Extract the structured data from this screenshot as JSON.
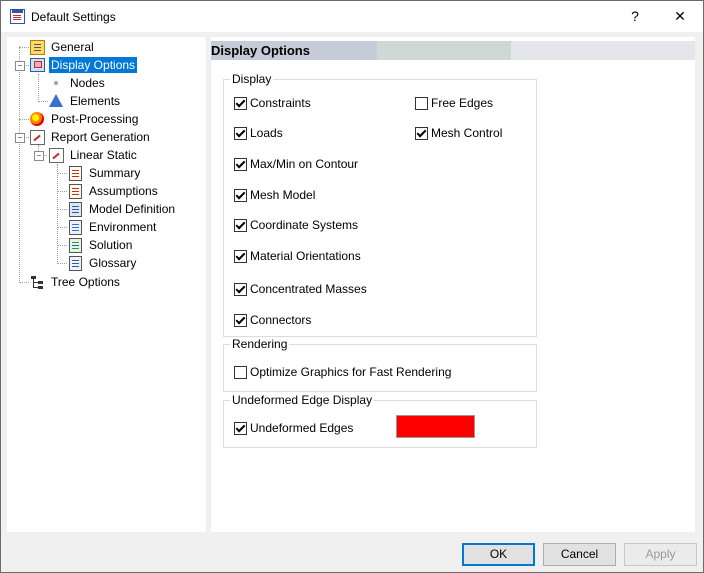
{
  "window": {
    "title": "Default Settings",
    "help_label": "?",
    "close_label": "✕"
  },
  "tree": {
    "nodes": [
      {
        "label": "General"
      },
      {
        "label": "Display Options"
      },
      {
        "label": "Nodes"
      },
      {
        "label": "Elements"
      },
      {
        "label": "Post-Processing"
      },
      {
        "label": "Report Generation"
      },
      {
        "label": "Linear Static"
      },
      {
        "label": "Summary"
      },
      {
        "label": "Assumptions"
      },
      {
        "label": "Model Definition"
      },
      {
        "label": "Environment"
      },
      {
        "label": "Solution"
      },
      {
        "label": "Glossary"
      },
      {
        "label": "Tree Options"
      }
    ],
    "selected": "Display Options"
  },
  "panel": {
    "header": "Display Options",
    "display_group": {
      "title": "Display",
      "options": [
        {
          "label": "Constraints",
          "checked": true
        },
        {
          "label": "Loads",
          "checked": true
        },
        {
          "label": "Max/Min on Contour",
          "checked": true
        },
        {
          "label": "Mesh Model",
          "checked": true
        },
        {
          "label": "Coordinate Systems",
          "checked": true
        },
        {
          "label": "Material Orientations",
          "checked": true
        },
        {
          "label": "Concentrated Masses",
          "checked": true
        },
        {
          "label": "Connectors",
          "checked": true
        },
        {
          "label": "Free Edges",
          "checked": false
        },
        {
          "label": "Mesh Control",
          "checked": true
        }
      ]
    },
    "rendering_group": {
      "title": "Rendering",
      "options": [
        {
          "label": "Optimize Graphics for Fast Rendering",
          "checked": false
        }
      ]
    },
    "edge_group": {
      "title": "Undeformed Edge Display",
      "options": [
        {
          "label": "Undeformed Edges",
          "checked": true
        }
      ],
      "edge_color": "#ff0000"
    }
  },
  "buttons": {
    "ok": "OK",
    "cancel": "Cancel",
    "apply": "Apply"
  },
  "colors": {
    "selection": "#0078d7",
    "default_button_border": "#0078d7"
  }
}
